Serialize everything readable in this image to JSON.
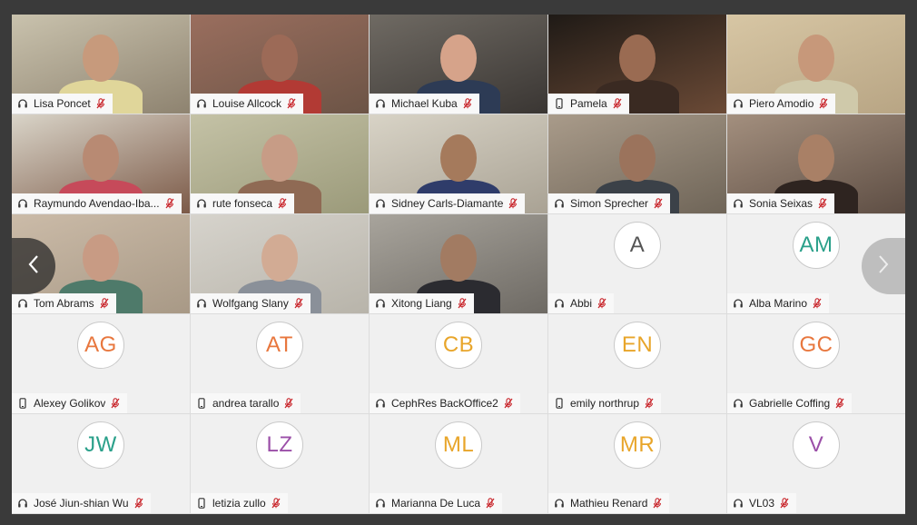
{
  "colors": {
    "mute": "#c8242a",
    "background": "#3a3a3a"
  },
  "nav": {
    "prev_icon": "chevron-left-icon",
    "next_icon": "chevron-right-icon"
  },
  "participants": [
    {
      "name": "Lisa Poncet",
      "device": "headset",
      "type": "video",
      "scene": [
        "#c9c2ad",
        "#8e8370",
        "#c79a7c",
        "#e0d69a"
      ]
    },
    {
      "name": "Louise Allcock",
      "device": "headset",
      "type": "video",
      "scene": [
        "#9a6e5e",
        "#6c5446",
        "#9c6a57",
        "#b23a34"
      ]
    },
    {
      "name": "Michael Kuba",
      "device": "headset",
      "type": "video",
      "scene": [
        "#6f6a63",
        "#3a3633",
        "#d6a38a",
        "#2d3b55"
      ]
    },
    {
      "name": "Pamela",
      "device": "phone",
      "type": "video",
      "scene": [
        "#1f1a16",
        "#6b4a36",
        "#9a6b52",
        "#3a2a22"
      ]
    },
    {
      "name": "Piero Amodio",
      "device": "headset",
      "type": "video",
      "scene": [
        "#d7c6a4",
        "#b8a584",
        "#c7987a",
        "#cfc9aa"
      ]
    },
    {
      "name": "Raymundo Avendao-Iba...",
      "device": "headset",
      "type": "video",
      "scene": [
        "#d9d4c8",
        "#7c5a48",
        "#b88a73",
        "#c64a5a"
      ]
    },
    {
      "name": "rute fonseca",
      "device": "headset",
      "type": "video",
      "scene": [
        "#c4c2a6",
        "#9b9a7a",
        "#c79c86",
        "#8f6a54"
      ]
    },
    {
      "name": "Sidney Carls-Diamante",
      "device": "headset",
      "type": "video",
      "scene": [
        "#d8d3c6",
        "#a9a294",
        "#a57a5c",
        "#2f3c6a"
      ]
    },
    {
      "name": "Simon Sprecher",
      "device": "headset",
      "type": "video",
      "scene": [
        "#a99b8a",
        "#6f6558",
        "#9b735c",
        "#3b4148"
      ]
    },
    {
      "name": "Sonia Seixas",
      "device": "headset",
      "type": "video",
      "scene": [
        "#a38f7e",
        "#5e4e44",
        "#a98066",
        "#2e2420"
      ]
    },
    {
      "name": "Tom Abrams",
      "device": "headset",
      "type": "video",
      "scene": [
        "#cbbba8",
        "#a89986",
        "#c89b84",
        "#4e7a6a"
      ]
    },
    {
      "name": "Wolfgang Slany",
      "device": "headset",
      "type": "video",
      "scene": [
        "#d6d3cc",
        "#b8b4aa",
        "#d2ab94",
        "#8a9099"
      ]
    },
    {
      "name": "Xitong Liang",
      "device": "headset",
      "type": "video",
      "scene": [
        "#a8a49c",
        "#6e6a64",
        "#a27b62",
        "#2b2b30"
      ]
    },
    {
      "name": "Abbi",
      "device": "headset",
      "type": "avatar",
      "initials": "A",
      "color": "#555555"
    },
    {
      "name": "Alba Marino",
      "device": "headset",
      "type": "avatar",
      "initials": "AM",
      "color": "#2aa08a"
    },
    {
      "name": "Alexey Golikov",
      "device": "phone",
      "type": "avatar",
      "initials": "AG",
      "color": "#e8773e"
    },
    {
      "name": "andrea tarallo",
      "device": "phone",
      "type": "avatar",
      "initials": "AT",
      "color": "#e8773e"
    },
    {
      "name": "CephRes BackOffice2",
      "device": "headset",
      "type": "avatar",
      "initials": "CB",
      "color": "#e8a52a"
    },
    {
      "name": "emily northrup",
      "device": "phone",
      "type": "avatar",
      "initials": "EN",
      "color": "#e8a52a"
    },
    {
      "name": "Gabrielle Coffing",
      "device": "headset",
      "type": "avatar",
      "initials": "GC",
      "color": "#e8773e"
    },
    {
      "name": "José Jiun-shian Wu",
      "device": "headset",
      "type": "avatar",
      "initials": "JW",
      "color": "#2aa08a"
    },
    {
      "name": "letizia zullo",
      "device": "phone",
      "type": "avatar",
      "initials": "LZ",
      "color": "#9b4fa8"
    },
    {
      "name": "Marianna De Luca",
      "device": "headset",
      "type": "avatar",
      "initials": "ML",
      "color": "#e8a52a"
    },
    {
      "name": "Mathieu Renard",
      "device": "headset",
      "type": "avatar",
      "initials": "MR",
      "color": "#e8a52a"
    },
    {
      "name": "VL03",
      "device": "headset",
      "type": "avatar",
      "initials": "V",
      "color": "#9b4fa8"
    }
  ]
}
